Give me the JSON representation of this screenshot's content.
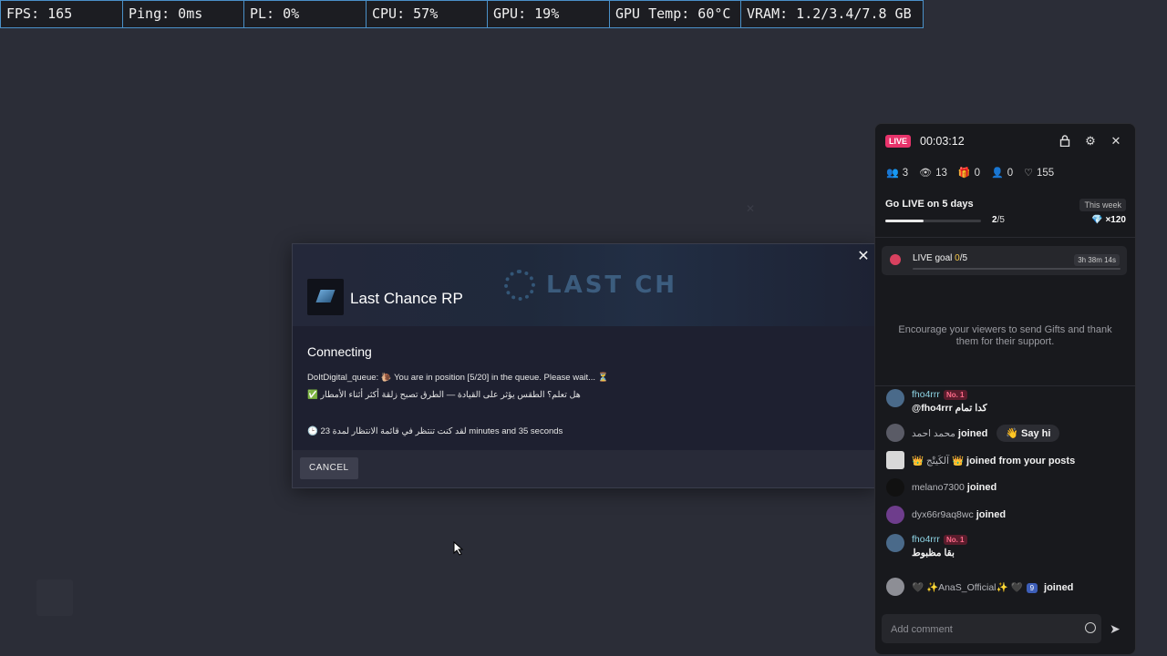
{
  "stats_bar": {
    "fps": "FPS: 165",
    "ping": "Ping: 0ms",
    "pl": "PL: 0%",
    "cpu": "CPU: 57%",
    "gpu": "GPU: 19%",
    "gpu_temp": "GPU Temp: 60°C",
    "vram": "VRAM: 1.2/3.4/7.8 GB"
  },
  "dialog": {
    "banner_text": "LAST CH",
    "title": "Last Chance RP",
    "heading": "Connecting",
    "queue_line": "DoItDigital_queue: 🐌 You are in position [5/20] in the queue. Please wait... ⏳",
    "tip_line": "✅ هل تعلم؟ الطقس يؤثر على القيادة — الطرق تصبح زلقة أكثر أثناء الأمطار",
    "wait_line": "🕒 لقد كنت تنتظر في قائمة الانتظار لمدة 23 minutes and 35 seconds",
    "cancel_label": "CANCEL",
    "close_icon": "close-icon"
  },
  "live_panel": {
    "badge": "LIVE",
    "timer": "00:03:12",
    "icons": [
      "lock-icon",
      "gear-icon",
      "close-icon"
    ],
    "stats": [
      {
        "icon": "users-icon",
        "value": "3"
      },
      {
        "icon": "eye-icon",
        "value": "13"
      },
      {
        "icon": "gift-icon",
        "value": "0"
      },
      {
        "icon": "user-plus-icon",
        "value": "0"
      },
      {
        "icon": "heart-icon",
        "value": "155"
      }
    ],
    "go_live": {
      "title": "Go LIVE on 5 days",
      "period": "This week",
      "progress_current": "2",
      "progress_total": "/5",
      "progress_fraction": 0.4,
      "reward": "×120"
    },
    "goal": {
      "label": "LIVE goal ",
      "value": "0",
      "total": "/5",
      "time_left": "3h 38m 14s",
      "progress_fraction": 0
    },
    "encourage": "Encourage your viewers to send Gifts and thank them for their support.",
    "messages": [
      {
        "user": "fho4rrr",
        "badge": "No. 1",
        "text": "@fho4rrr كدا تمام"
      },
      {
        "user": "محمد احمد",
        "action": "joined",
        "button": "👋 Say hi"
      },
      {
        "user": "👑 آلكَيتْج 👑",
        "action": "joined from your posts"
      },
      {
        "user": "melano7300",
        "action": "joined"
      },
      {
        "user": "dyx66r9aq8wc",
        "action": "joined"
      },
      {
        "user": "fho4rrr",
        "badge": "No. 1",
        "text": "بقا مظبوط"
      },
      {
        "user": "🖤 ✨AnaS_Official✨ 🖤",
        "level": "9",
        "action": "joined"
      }
    ],
    "comment_placeholder": "Add comment"
  },
  "colors": {
    "accent_live": "#e8336b",
    "stats_border": "#4a90c8",
    "username": "#8fd6e6"
  }
}
